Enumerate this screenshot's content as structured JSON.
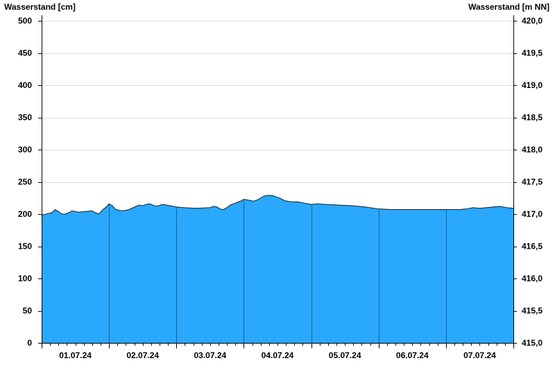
{
  "chart_data": {
    "type": "area",
    "title": "",
    "ylabel_left": "Wasserstand [cm]",
    "ylabel_right": "Wasserstand [m NN]",
    "xlabel": "",
    "grid": true,
    "ylim": [
      0,
      500
    ],
    "y_ticks_left": [
      "0",
      "50",
      "100",
      "150",
      "200",
      "250",
      "300",
      "350",
      "400",
      "450",
      "500"
    ],
    "y2lim": [
      415.0,
      420.0
    ],
    "y_ticks_right": [
      "415,0",
      "415,5",
      "416,0",
      "416,5",
      "417,0",
      "417,5",
      "418,0",
      "418,5",
      "419,0",
      "419,5",
      "420,0"
    ],
    "x_range_days": [
      0,
      7
    ],
    "day_labels": [
      "01.07.24",
      "02.07.24",
      "03.07.24",
      "04.07.24",
      "05.07.24",
      "06.07.24",
      "07.07.24"
    ],
    "area_color": "#29a8fd",
    "day_line_color": "#1f5f9a",
    "series": [
      {
        "x": [
          0.0,
          0.1,
          0.15,
          0.2,
          0.25,
          0.3,
          0.35,
          0.4,
          0.45,
          0.55,
          0.65,
          0.75,
          0.8,
          0.85,
          0.9,
          0.92,
          0.95,
          1.0,
          1.05,
          1.1,
          1.15,
          1.2,
          1.3,
          1.4,
          1.45,
          1.5,
          1.55,
          1.6,
          1.7,
          1.8,
          1.85,
          1.9,
          2.0,
          2.1,
          2.3,
          2.5,
          2.55,
          2.6,
          2.65,
          2.7,
          2.75,
          2.8,
          2.85,
          2.9,
          2.95,
          3.0,
          3.05,
          3.1,
          3.15,
          3.2,
          3.3,
          3.35,
          3.4,
          3.45,
          3.5,
          3.55,
          3.6,
          3.7,
          3.8,
          3.9,
          4.0,
          4.1,
          4.2,
          4.4,
          4.6,
          4.8,
          5.0,
          5.2,
          5.5,
          6.0,
          6.1,
          6.2,
          6.3,
          6.4,
          6.5,
          6.6,
          6.7,
          6.8,
          6.9,
          7.0
        ],
        "values": [
          198,
          201,
          202,
          207,
          204,
          200,
          200,
          202,
          205,
          203,
          204,
          205,
          202,
          200,
          206,
          208,
          210,
          216,
          213,
          207,
          206,
          205,
          207,
          212,
          214,
          213,
          215,
          216,
          212,
          215,
          214,
          213,
          211,
          210,
          209,
          210,
          212,
          211,
          208,
          207,
          210,
          214,
          216,
          218,
          220,
          223,
          222,
          221,
          220,
          222,
          228,
          229,
          229,
          228,
          226,
          224,
          221,
          219,
          219,
          217,
          215,
          216,
          215,
          214,
          213,
          211,
          208,
          207,
          207,
          207,
          207,
          207,
          208,
          210,
          209,
          210,
          211,
          212,
          210,
          209
        ]
      }
    ]
  }
}
